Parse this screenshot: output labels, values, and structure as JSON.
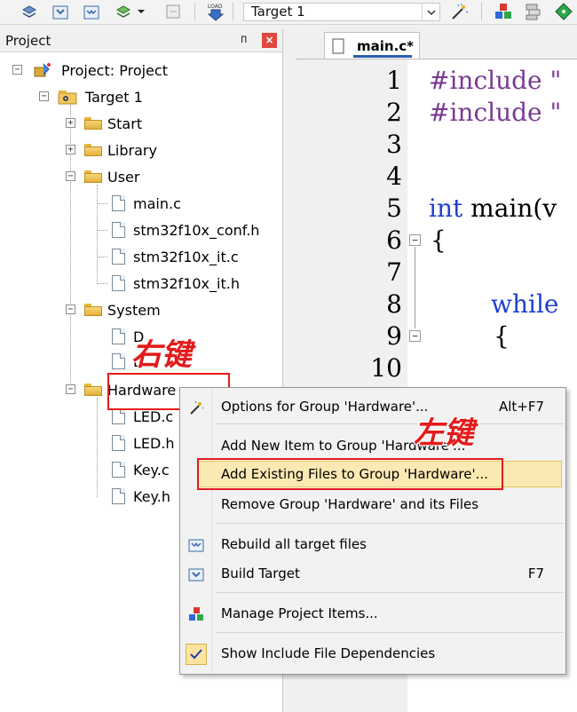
{
  "toolbar": {
    "target_value": "Target 1",
    "icons": [
      "build-icon",
      "rebuild-icon",
      "batch-build-icon",
      "stack-icon",
      "dropdown-arrow-icon",
      "translate-icon",
      "load-icon",
      "wand-icon",
      "manage-icon",
      "layers-icon",
      "diamond-icon"
    ]
  },
  "project_panel": {
    "title": "Project",
    "tree": {
      "root": "Project: Project",
      "target": "Target 1",
      "groups": {
        "start": "Start",
        "library": "Library",
        "user": "User",
        "system": "System",
        "hardware": "Hardware"
      },
      "user_files": [
        "main.c",
        "stm32f10x_conf.h",
        "stm32f10x_it.c",
        "stm32f10x_it.h"
      ],
      "system_files_partial": [
        "D",
        "D"
      ],
      "hardware_files_partial": [
        "LED.c",
        "LED.h",
        "Key.c",
        "Key.h"
      ]
    }
  },
  "editor": {
    "tab_label": "main.c*",
    "line_numbers": [
      "1",
      "2",
      "3",
      "4",
      "5",
      "6",
      "7",
      "8",
      "9",
      "10"
    ],
    "code_lines": {
      "l1": "#include \"",
      "l2": "#include \"",
      "l5_kw": "int",
      "l5_rest": " main(v",
      "l6": "{",
      "l8": "while",
      "l9": "{"
    }
  },
  "annotations": {
    "right_click": "右键",
    "left_click": "左键"
  },
  "context_menu": {
    "items": [
      {
        "label": "Options for Group 'Hardware'...",
        "shortcut": "Alt+F7"
      },
      {
        "label": "Add New  Item to Group 'Hardware'...",
        "shortcut": ""
      },
      {
        "label": "Add Existing Files to Group 'Hardware'...",
        "shortcut": ""
      },
      {
        "label": "Remove Group 'Hardware' and its Files",
        "shortcut": ""
      },
      {
        "label": "Rebuild all target files",
        "shortcut": ""
      },
      {
        "label": "Build Target",
        "shortcut": "F7"
      },
      {
        "label": "Manage Project Items...",
        "shortcut": ""
      },
      {
        "label": "Show Include File Dependencies",
        "shortcut": ""
      }
    ]
  }
}
